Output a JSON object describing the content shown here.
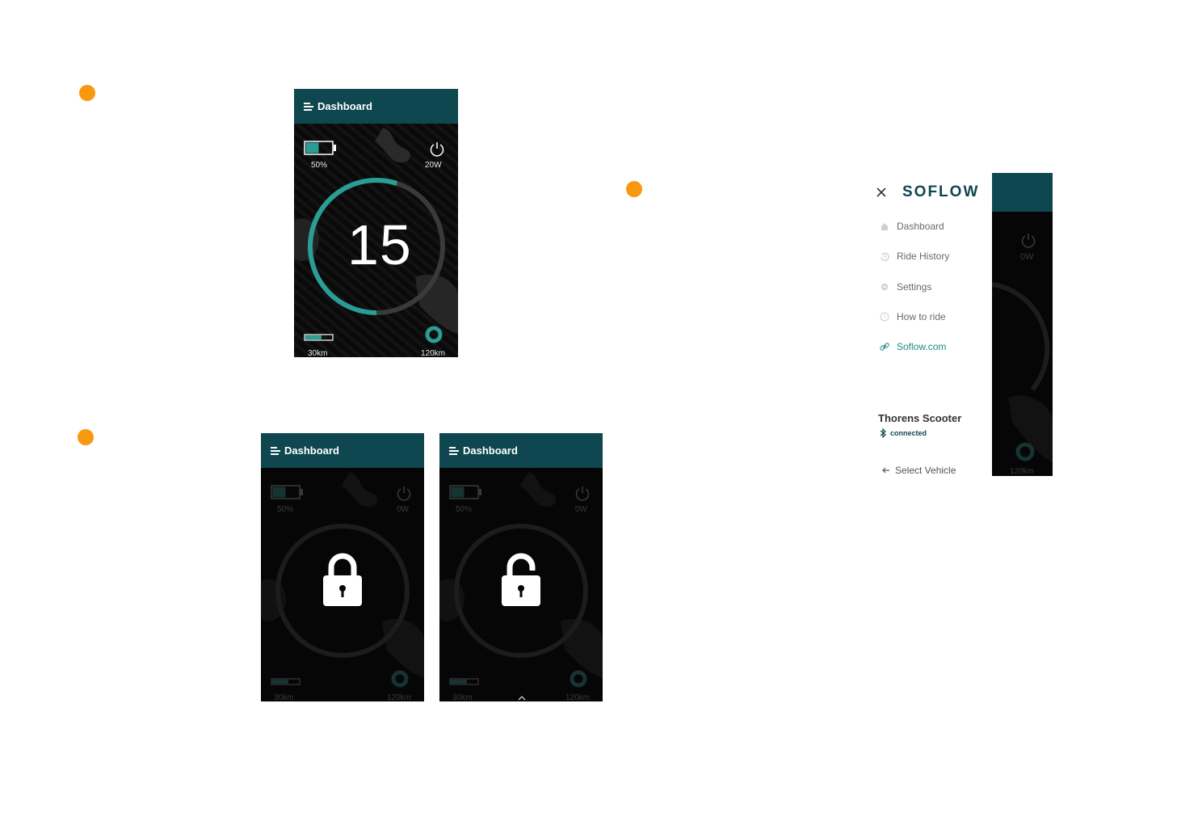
{
  "screen1": {
    "header_title": "Dashboard",
    "battery_label": "50%",
    "battery_level": 0.5,
    "power_label": "20W",
    "speed": "15",
    "speed_progress": 0.55,
    "range_min": "30km",
    "range_max": "120km"
  },
  "screen_locked": {
    "header_title": "Dashboard",
    "battery_label": "50%",
    "power_label": "0W",
    "range_min": "30km",
    "range_max": "120km"
  },
  "screen_unlocked": {
    "header_title": "Dashboard",
    "battery_label": "50%",
    "power_label": "0W",
    "range_min": "30km",
    "range_max": "120km"
  },
  "sidebar": {
    "brand": "SOFLOW",
    "items": [
      {
        "label": "Dashboard",
        "icon": "home-icon"
      },
      {
        "label": "Ride History",
        "icon": "history-icon"
      },
      {
        "label": "Settings",
        "icon": "gear-icon"
      },
      {
        "label": "How to ride",
        "icon": "help-icon"
      },
      {
        "label": "Soflow.com",
        "icon": "link-icon"
      }
    ],
    "vehicle_name": "Thorens Scooter",
    "vehicle_status": "connected",
    "select_vehicle": "Select Vehicle",
    "peek_power": "0W",
    "peek_range": "120km"
  },
  "colors": {
    "header": "#0e474f",
    "accent": "#2a9d95",
    "orange": "#f7980f"
  }
}
